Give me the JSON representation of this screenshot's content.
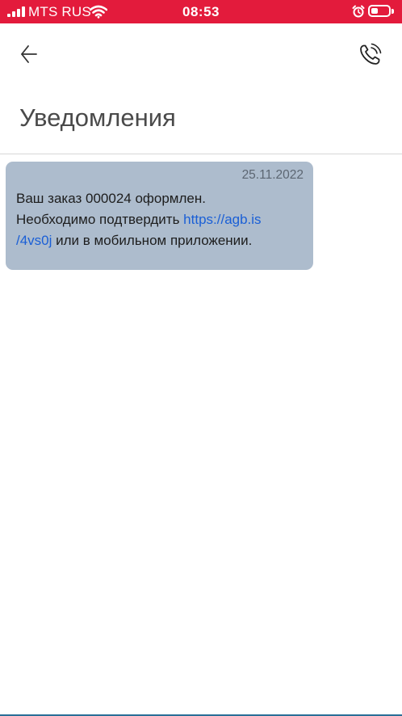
{
  "status_bar": {
    "carrier": "MTS RUS",
    "time": "08:53",
    "background_color": "#e31b3c",
    "signal_icon": "signal-icon",
    "wifi_icon": "wifi-icon",
    "alarm_icon": "alarm-icon",
    "battery_icon": "battery-icon"
  },
  "header": {
    "back_icon": "arrow-left-icon",
    "call_icon": "phone-call-icon",
    "title": "Уведомления"
  },
  "messages": [
    {
      "date": "25.11.2022",
      "text_line1": "Ваш заказ 000024 оформлен.",
      "text_before_link": "Необходимо подтвердить ",
      "link_part1": "https://agb.is",
      "link_part2": "/4vs0j",
      "text_after_link": " или в мобильном приложении.",
      "bubble_color": "#adbccd",
      "link_color": "#1a5fd6"
    }
  ]
}
